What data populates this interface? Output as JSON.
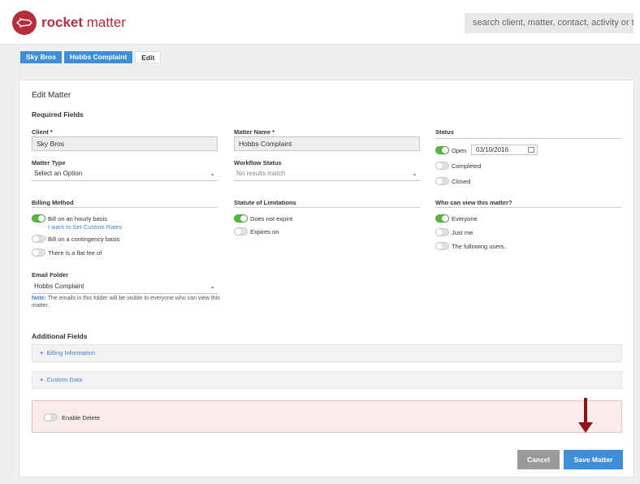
{
  "brand": {
    "name_bold": "rocket",
    "name_rest": " matter",
    "color": "#b32d3a"
  },
  "search": {
    "placeholder": "search client, matter, contact, activity or tag"
  },
  "breadcrumb": [
    {
      "label": "Sky Bros"
    },
    {
      "label": "Hobbs Complaint"
    },
    {
      "label": "Edit"
    }
  ],
  "form": {
    "title": "Edit Matter",
    "required_heading": "Required Fields",
    "client": {
      "label": "Client *",
      "value": "Sky Bros"
    },
    "matter_name": {
      "label": "Matter Name *",
      "value": "Hobbs Complaint"
    },
    "status": {
      "label": "Status",
      "options": [
        {
          "label": "Open",
          "on": true
        },
        {
          "label": "Completed",
          "on": false
        },
        {
          "label": "Closed",
          "on": false
        }
      ],
      "date": "03/10/2016"
    },
    "matter_type": {
      "label": "Matter Type",
      "value": "Select an Option"
    },
    "workflow_status": {
      "label": "Workflow Status",
      "value": "No results match"
    },
    "billing_method": {
      "label": "Billing Method",
      "options": [
        {
          "label": "Bill on an hourly basis",
          "on": true
        },
        {
          "label": "Bill on a contingency basis",
          "on": false
        },
        {
          "label": "There is a flat fee of",
          "on": false
        }
      ],
      "custom_rates_link": "I want to Set Custom Rates"
    },
    "statute": {
      "label": "Statute of Limitations",
      "options": [
        {
          "label": "Does not expire",
          "on": true
        },
        {
          "label": "Expires on",
          "on": false
        }
      ]
    },
    "visibility": {
      "label": "Who can view this matter?",
      "options": [
        {
          "label": "Everyone",
          "on": true
        },
        {
          "label": "Just me",
          "on": false
        },
        {
          "label": "The following users..",
          "on": false
        }
      ]
    },
    "email_folder": {
      "label": "Email Folder",
      "value": "Hobbs Complaint",
      "note_prefix": "Note:",
      "note_text": " The emails in this folder will be visible to everyone who can view this matter."
    },
    "additional_heading": "Additional Fields",
    "billing_info": "Billing Information",
    "custom_data": "Custom Data",
    "enable_delete": {
      "label": "Enable Delete",
      "on": false
    },
    "cancel_label": "Cancel",
    "save_label": "Save Matter"
  },
  "colors": {
    "accent": "#3f8fd8",
    "toggle_on": "#57b83f",
    "annotation_arrow": "#8b1414"
  }
}
